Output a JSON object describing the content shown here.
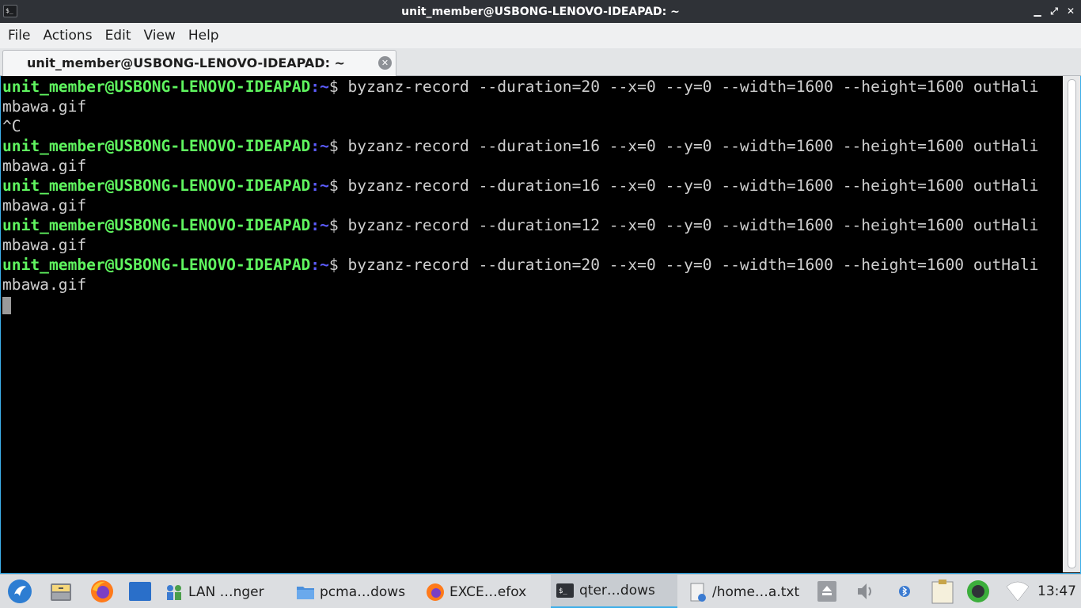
{
  "window": {
    "title": "unit_member@USBONG-LENOVO-IDEAPAD: ~",
    "app_icon": "$_",
    "controls": {
      "minimize": "▁",
      "maximize": "⤢",
      "close": "✕"
    }
  },
  "menu": {
    "items": [
      "File",
      "Actions",
      "Edit",
      "View",
      "Help"
    ]
  },
  "tabs": [
    {
      "label": "unit_member@USBONG-LENOVO-IDEAPAD: ~",
      "close_icon": "close-icon"
    }
  ],
  "terminal": {
    "prompt_user": "unit_member@USBONG-LENOVO-IDEAPAD",
    "prompt_path": ":~",
    "prompt_symbol": "$",
    "lines": [
      {
        "type": "cmd",
        "text": " byzanz-record --duration=20 --x=0 --y=0 --width=1600 --height=1600 outHali"
      },
      {
        "type": "out",
        "text": "mbawa.gif"
      },
      {
        "type": "out",
        "text": "^C"
      },
      {
        "type": "cmd",
        "text": " byzanz-record --duration=16 --x=0 --y=0 --width=1600 --height=1600 outHali"
      },
      {
        "type": "out",
        "text": "mbawa.gif"
      },
      {
        "type": "cmd",
        "text": " byzanz-record --duration=16 --x=0 --y=0 --width=1600 --height=1600 outHali"
      },
      {
        "type": "out",
        "text": "mbawa.gif"
      },
      {
        "type": "cmd",
        "text": " byzanz-record --duration=12 --x=0 --y=0 --width=1600 --height=1600 outHali"
      },
      {
        "type": "out",
        "text": "mbawa.gif"
      },
      {
        "type": "cmd",
        "text": " byzanz-record --duration=20 --x=0 --y=0 --width=1600 --height=1600 outHali"
      },
      {
        "type": "out",
        "text": "mbawa.gif"
      }
    ]
  },
  "taskbar": {
    "launchers": [
      {
        "name": "start-menu-icon"
      },
      {
        "name": "file-cabinet-icon"
      },
      {
        "name": "firefox-icon"
      },
      {
        "name": "show-desktop-icon"
      }
    ],
    "tasks": [
      {
        "label": "LAN …nger",
        "icon": "network-manager-icon",
        "active": false
      },
      {
        "label": "pcma…dows",
        "icon": "folder-icon",
        "active": false
      },
      {
        "label": "EXCE…efox",
        "icon": "firefox-icon",
        "active": false
      },
      {
        "label": "qter…dows",
        "icon": "terminal-icon",
        "active": true
      },
      {
        "label": "/home…a.txt",
        "icon": "text-editor-icon",
        "active": false
      }
    ],
    "tray": [
      "eject-icon",
      "volume-icon",
      "bluetooth-icon",
      "clipboard-icon",
      "update-ring-icon",
      "wifi-icon"
    ],
    "clock": "13:47"
  },
  "colors": {
    "prompt_user": "#5ff55f",
    "prompt_path": "#5c5cff",
    "terminal_bg": "#000000",
    "terminal_fg": "#cfcfcf",
    "accent": "#3daee9"
  }
}
